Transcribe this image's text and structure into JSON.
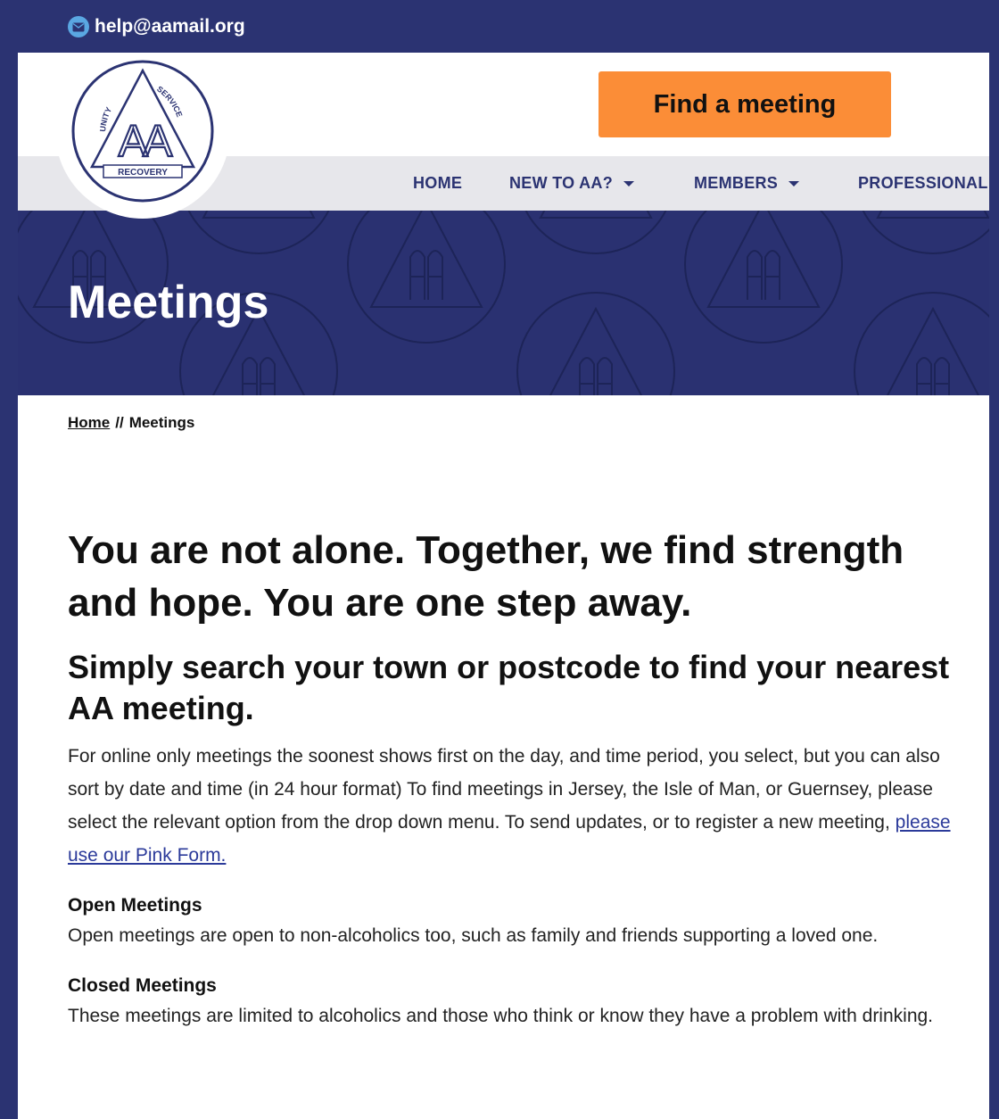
{
  "topbar": {
    "email": "help@aamail.org",
    "icon": "mail-icon"
  },
  "header": {
    "find_meeting_label": "Find a meeting",
    "logo": {
      "left_word": "UNITY",
      "right_word": "SERVICE",
      "bottom_word": "RECOVERY",
      "center_text": "AA"
    }
  },
  "nav": {
    "items": [
      {
        "label": "HOME",
        "dropdown": false
      },
      {
        "label": "NEW TO AA?",
        "dropdown": true
      },
      {
        "label": "MEMBERS",
        "dropdown": true
      },
      {
        "label": "PROFESSIONAL",
        "dropdown": false
      }
    ]
  },
  "hero": {
    "title": "Meetings"
  },
  "breadcrumb": {
    "home": "Home",
    "separator": "//",
    "current": "Meetings"
  },
  "content": {
    "heading": "You are not alone. Together, we find strength and hope. You are one step away.",
    "subheading": "Simply search your town or postcode to find your nearest AA meeting.",
    "intro": "For online only meetings the soonest shows first on the day, and time period, you select, but you can also sort by date and time (in 24 hour format) To find meetings in Jersey, the Isle of Man, or Guernsey, please select the relevant option from the drop down menu. To send updates, or to register a new meeting,",
    "intro_link": "please use our Pink Form.",
    "open_title": "Open Meetings",
    "open_text": "Open meetings are open to non-alcoholics too, such as family and friends supporting a loved one.",
    "closed_title": "Closed Meetings",
    "closed_text": "These meetings are limited to alcoholics and those who think or know they have a problem with drinking."
  },
  "colors": {
    "navy": "#2b3372",
    "orange": "#fb8d37",
    "nav_bg": "#e7e7eb",
    "mail_icon": "#5aa7e2"
  }
}
